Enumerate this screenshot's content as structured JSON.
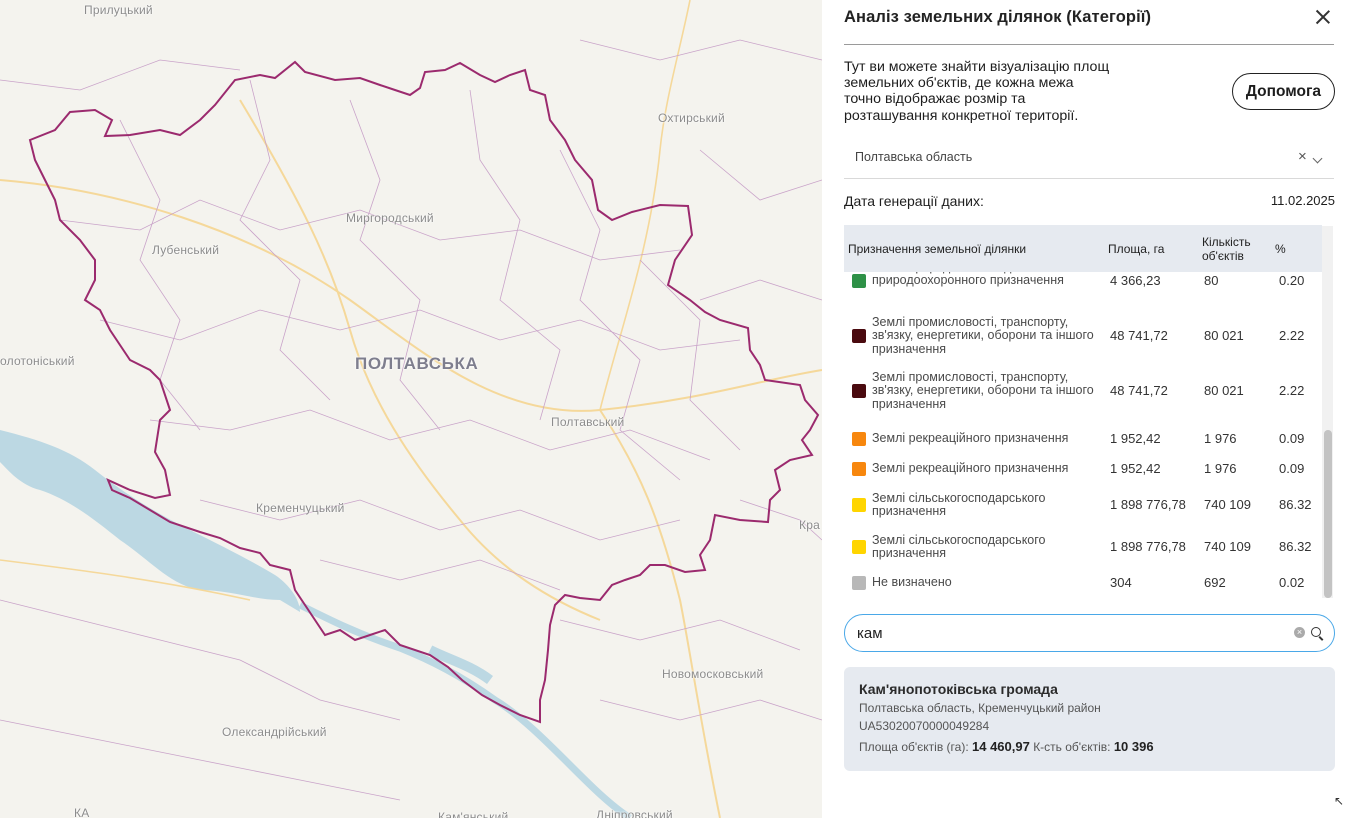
{
  "map": {
    "labels": {
      "pryluky": "Прилуцький",
      "okhtyrka": "Охтирський",
      "myrhorod": "Миргородський",
      "lubny": "Лубенський",
      "zolotonosha": "олотоніський",
      "poltava_region": "ПОЛТАВСЬКА",
      "poltava_district": "Полтавський",
      "kremenchuk": "Кременчуцький",
      "novomoskovsk": "Новомосковський",
      "oleksandriia": "Олександрійський",
      "kamianske": "Кам'янський",
      "dnipro": "Дніпровський",
      "kra": "Кра",
      "ka": "КА"
    },
    "border_color": "#9b2a6e"
  },
  "panel": {
    "title": "Аналіз земельних ділянок (Категорії)",
    "intro": "Тут ви можете знайти візуалізацію площ земельних об'єктів, де кожна межа точно відображає розмір та розташування конкретної території.",
    "help_label": "Допомога",
    "region_select": {
      "value": "Полтавська область",
      "clear": "×"
    },
    "generation_label": "Дата генерації даних:",
    "generation_date": "11.02.2025",
    "table": {
      "headers": {
        "name": "Призначення земельної ділянки",
        "area": "Площа, га",
        "count": "Кількість об'єктів",
        "pct": "%"
      },
      "rows": [
        {
          "name": "Землі природно-заповідного та іншого природоохоронного призначення",
          "color": "#2e9147",
          "area": "4 366,23",
          "count": "80",
          "pct": "0.20"
        },
        {
          "name": "Землі промисловості, транспорту, зв'язку, енергетики, оборони та іншого призначення",
          "color": "#4a0a0f",
          "area": "48 741,72",
          "count": "80 021",
          "pct": "2.22"
        },
        {
          "name": "Землі промисловості, транспорту, зв'язку, енергетики, оборони та іншого призначення",
          "color": "#4a0a0f",
          "area": "48 741,72",
          "count": "80 021",
          "pct": "2.22"
        },
        {
          "name": "Землі рекреаційного призначення",
          "color": "#f7870e",
          "area": "1 952,42",
          "count": "1 976",
          "pct": "0.09"
        },
        {
          "name": "Землі рекреаційного призначення",
          "color": "#f7870e",
          "area": "1 952,42",
          "count": "1 976",
          "pct": "0.09"
        },
        {
          "name": "Землі сільськогосподарського призначення",
          "color": "#ffd500",
          "area": "1 898 776,78",
          "count": "740 109",
          "pct": "86.32"
        },
        {
          "name": "Землі сільськогосподарського призначення",
          "color": "#ffd500",
          "area": "1 898 776,78",
          "count": "740 109",
          "pct": "86.32"
        },
        {
          "name": "Не визначено",
          "color": "#b8b8b8",
          "area": "304",
          "count": "692",
          "pct": "0.02"
        }
      ]
    },
    "search": {
      "value": "кам"
    },
    "result": {
      "name": "Кам'янопотоківська громада",
      "location": "Полтавська область, Кременчуцький район",
      "code": "UA53020070000049284",
      "area_label": "Площа об'єктів (га):",
      "area_value": "14 460,97",
      "count_label": "К-сть об'єктів:",
      "count_value": "10 396"
    }
  }
}
